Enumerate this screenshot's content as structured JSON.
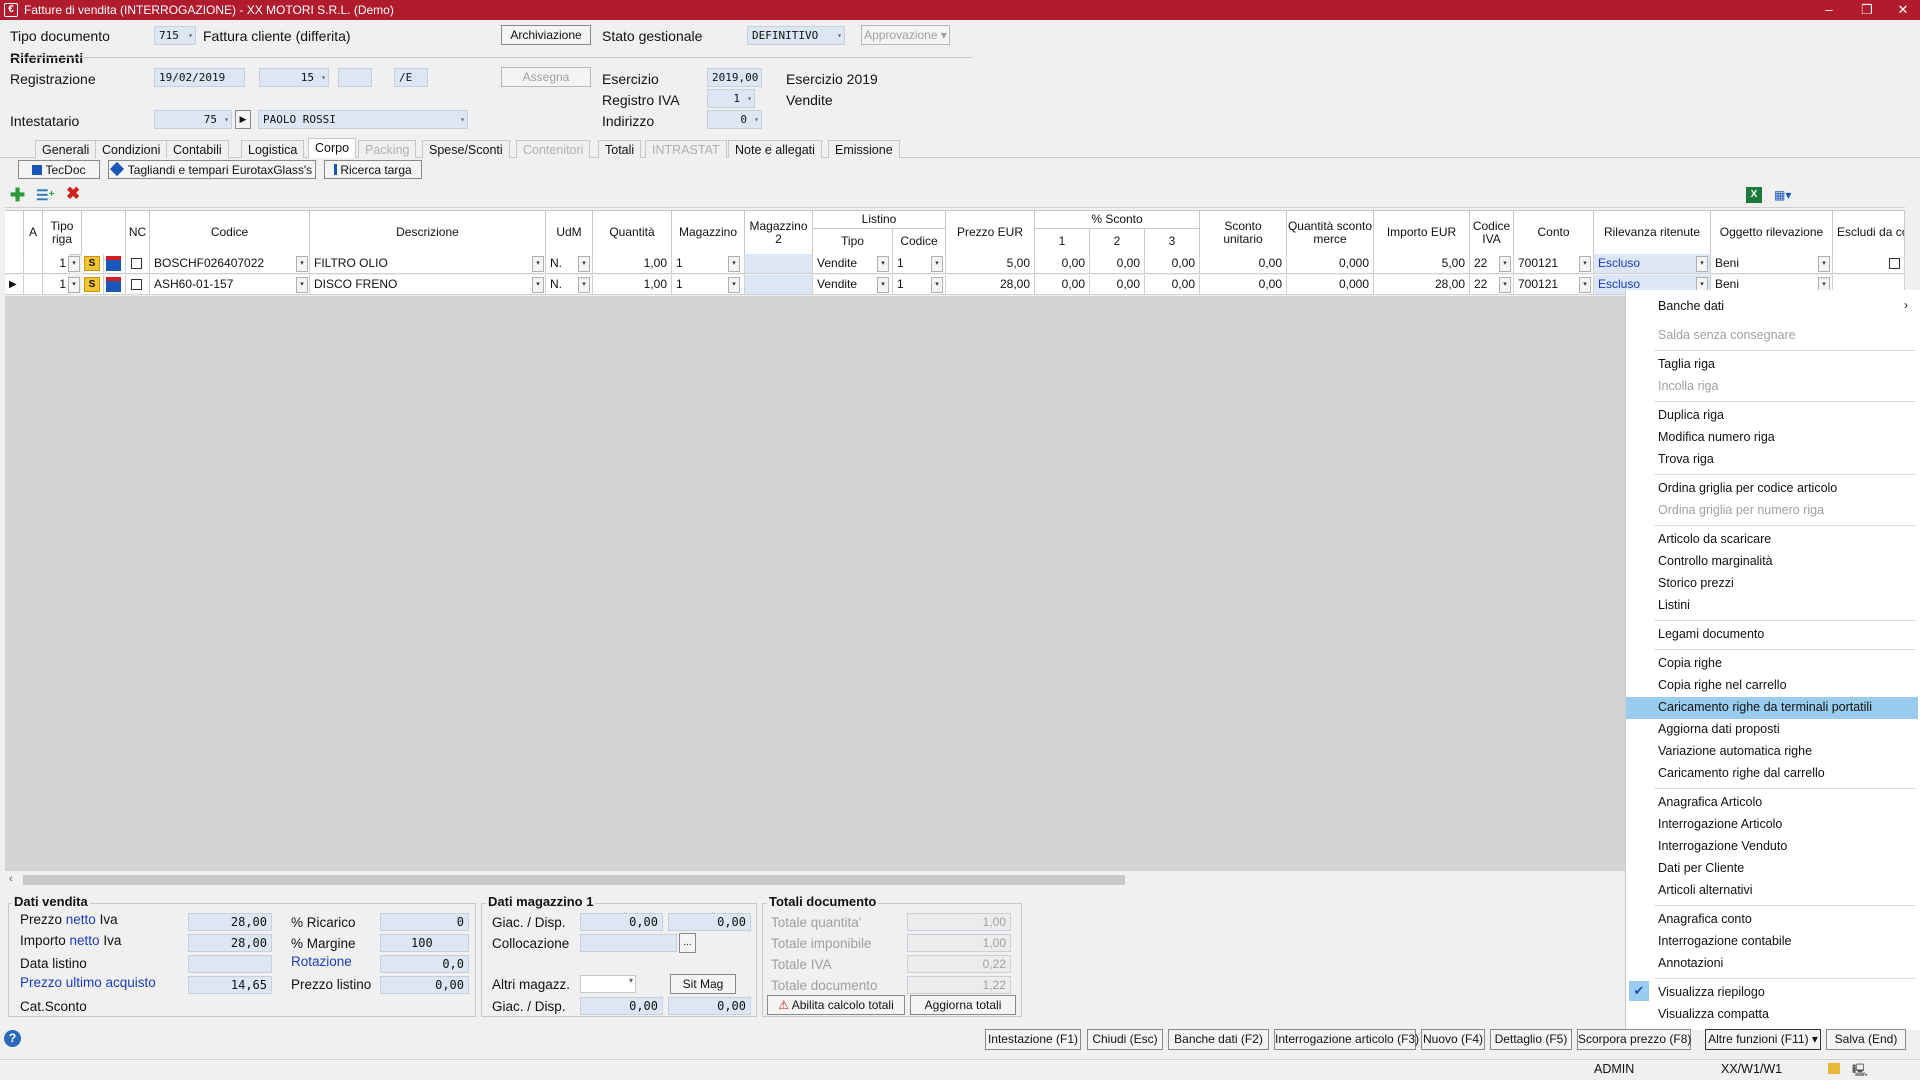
{
  "window": {
    "title": "Fatture di vendita (INTERROGAZIONE)  - XX  MOTORI S.R.L.  (Demo)",
    "minimize": "–",
    "restore": "❐",
    "close": "✕"
  },
  "header": {
    "tipo_documento_label": "Tipo documento",
    "tipo_documento_code": "715",
    "tipo_documento_desc": "Fattura cliente (differita)",
    "archiviazione_btn": "Archiviazione",
    "stato_gestionale_label": "Stato gestionale",
    "stato_gestionale_value": "DEFINITIVO",
    "approvazione_btn": "Approvazione",
    "riferimenti_label": "Riferimenti",
    "registrazione_label": "Registrazione",
    "registrazione_date": "19/02/2019",
    "registrazione_num": "15",
    "registrazione_suffix": "/E",
    "assegna_btn": "Assegna",
    "esercizio_label": "Esercizio",
    "esercizio_value": "2019,00",
    "esercizio_desc": "Esercizio 2019",
    "registro_iva_label": "Registro IVA",
    "registro_iva_value": "1",
    "registro_iva_desc": "Vendite",
    "intestatario_label": "Intestatario",
    "intestatario_code": "75",
    "intestatario_name": "PAOLO ROSSI",
    "indirizzo_label": "Indirizzo",
    "indirizzo_value": "0"
  },
  "tabs": [
    {
      "label": "Generali",
      "state": "normal"
    },
    {
      "label": "Condizioni",
      "state": "normal"
    },
    {
      "label": "Contabili",
      "state": "normal"
    },
    {
      "label": "Logistica",
      "state": "normal"
    },
    {
      "label": "Corpo",
      "state": "active"
    },
    {
      "label": "Packing",
      "state": "disabled"
    },
    {
      "label": "Spese/Sconti",
      "state": "normal"
    },
    {
      "label": "Contenitori",
      "state": "disabled"
    },
    {
      "label": "Totali",
      "state": "normal"
    },
    {
      "label": "INTRASTAT",
      "state": "disabled"
    },
    {
      "label": "Note e allegati",
      "state": "normal"
    },
    {
      "label": "Emissione",
      "state": "normal"
    }
  ],
  "subtoolbar": {
    "tecdoc": "TecDoc",
    "tagliandi": "Tagliandi e tempari EurotaxGlass's",
    "ricerca_targa": "Ricerca targa"
  },
  "grid": {
    "headers": {
      "a": "A",
      "tipo_riga": "Tipo riga",
      "nc": "NC",
      "codice": "Codice",
      "descrizione": "Descrizione",
      "udm": "UdM",
      "quantita": "Quantità",
      "magazzino": "Magazzino",
      "magazzino2": "Magazzino 2",
      "listino": "Listino",
      "listino_tipo": "Tipo",
      "listino_codice": "Codice",
      "prezzo": "Prezzo EUR",
      "sconto": "% Sconto",
      "sconto1": "1",
      "sconto2": "2",
      "sconto3": "3",
      "sconto_unitario": "Sconto unitario",
      "qta_sconto_merce": "Quantità sconto merce",
      "importo": "Importo EUR",
      "codice_iva": "Codice IVA",
      "conto": "Conto",
      "rilevanza": "Rilevanza ritenute",
      "oggetto": "Oggetto rilevazione",
      "escludi": "Escludi da co operazi"
    },
    "rows": [
      {
        "tipo": "1",
        "s": "S",
        "codice": "BOSCHF026407022",
        "descrizione": "FILTRO OLIO",
        "udm": "N.",
        "quantita": "1,00",
        "magazzino": "1",
        "listino_tipo": "Vendite",
        "listino_codice": "1",
        "prezzo": "5,00",
        "sc1": "0,00",
        "sc2": "0,00",
        "sc3": "0,00",
        "sconto_unitario": "0,00",
        "qta_sconto": "0,000",
        "importo": "5,00",
        "iva": "22",
        "conto": "700121",
        "rilevanza": "Escluso",
        "oggetto": "Beni"
      },
      {
        "tipo": "1",
        "s": "S",
        "codice": "ASH60-01-157",
        "descrizione": "DISCO FRENO",
        "udm": "N.",
        "quantita": "1,00",
        "magazzino": "1",
        "listino_tipo": "Vendite",
        "listino_codice": "1",
        "prezzo": "28,00",
        "sc1": "0,00",
        "sc2": "0,00",
        "sc3": "0,00",
        "sconto_unitario": "0,00",
        "qta_sconto": "0,000",
        "importo": "28,00",
        "iva": "22",
        "conto": "700121",
        "rilevanza": "Escluso",
        "oggetto": "Beni"
      }
    ]
  },
  "context_menu": {
    "items": [
      {
        "label": "Banche dati",
        "state": "submenu"
      },
      {
        "label": "Salda senza consegnare",
        "state": "disabled"
      },
      {
        "label": "Taglia riga",
        "state": "normal"
      },
      {
        "label": "Incolla riga",
        "state": "disabled"
      },
      {
        "label": "Duplica riga",
        "state": "normal"
      },
      {
        "label": "Modifica numero riga",
        "state": "normal"
      },
      {
        "label": "Trova riga",
        "state": "normal"
      },
      {
        "label": "Ordina griglia per codice articolo",
        "state": "normal"
      },
      {
        "label": "Ordina griglia per numero riga",
        "state": "disabled"
      },
      {
        "label": "Articolo da scaricare",
        "state": "normal"
      },
      {
        "label": "Controllo marginalità",
        "state": "normal"
      },
      {
        "label": "Storico prezzi",
        "state": "normal"
      },
      {
        "label": "Listini",
        "state": "normal"
      },
      {
        "label": "Legami documento",
        "state": "normal"
      },
      {
        "label": "Copia righe",
        "state": "normal"
      },
      {
        "label": "Copia righe nel carrello",
        "state": "normal"
      },
      {
        "label": "Caricamento righe da terminali portatili",
        "state": "highlighted"
      },
      {
        "label": "Aggiorna dati proposti",
        "state": "normal"
      },
      {
        "label": "Variazione automatica righe",
        "state": "normal"
      },
      {
        "label": "Caricamento righe dal carrello",
        "state": "normal"
      },
      {
        "label": "Anagrafica Articolo",
        "state": "normal"
      },
      {
        "label": "Interrogazione Articolo",
        "state": "normal"
      },
      {
        "label": "Interrogazione Venduto",
        "state": "normal"
      },
      {
        "label": "Dati per Cliente",
        "state": "normal"
      },
      {
        "label": "Articoli alternativi",
        "state": "normal"
      },
      {
        "label": "Anagrafica conto",
        "state": "normal"
      },
      {
        "label": "Interrogazione contabile",
        "state": "normal"
      },
      {
        "label": "Annotazioni",
        "state": "normal"
      },
      {
        "label": "Visualizza riepilogo",
        "state": "checked"
      },
      {
        "label": "Visualizza compatta",
        "state": "normal"
      }
    ]
  },
  "dati_vendita": {
    "title": "Dati vendita",
    "prezzo_netto_label_a": "Prezzo ",
    "prezzo_netto_label_b": "netto",
    "prezzo_netto_label_c": " Iva",
    "prezzo_netto_value": "28,00",
    "importo_netto_label_a": "Importo ",
    "importo_netto_label_b": "netto",
    "importo_netto_label_c": " Iva",
    "importo_netto_value": "28,00",
    "data_listino_label": "Data listino",
    "data_listino_value": "",
    "prezzo_ultimo_label": "Prezzo ultimo acquisto",
    "prezzo_ultimo_value": "14,65",
    "cat_sconto_label": "Cat.Sconto",
    "ricarico_label": "% Ricarico",
    "ricarico_value": "0",
    "margine_label": "% Margine",
    "margine_value": "100",
    "rotazione_label": "Rotazione",
    "rotazione_value": "0,0",
    "prezzo_listino_label": "Prezzo listino",
    "prezzo_listino_value": "0,00"
  },
  "dati_magazzino": {
    "title": "Dati magazzino 1",
    "giac_label": "Giac. / Disp.",
    "giac1": "0,00",
    "disp1": "0,00",
    "collocazione_label": "Collocazione",
    "collocazione_btn": "...",
    "altri_label": "Altri magazz.",
    "sitmag_btn": "Sit Mag",
    "giac2_label": "Giac. / Disp.",
    "giac2": "0,00",
    "disp2": "0,00"
  },
  "totali_documento": {
    "title": "Totali documento",
    "quantita_label": "Totale quantita'",
    "quantita_value": "1,00",
    "imponibile_label": "Totale imponibile",
    "imponibile_value": "1,00",
    "iva_label": "Totale IVA",
    "iva_value": "0,22",
    "documento_label": "Totale documento",
    "documento_value": "1,22",
    "abilita_btn": "Abilita calcolo totali",
    "aggiorna_btn": "Aggiorna totali"
  },
  "footer": {
    "buttons": [
      "Intestazione (F1)",
      "Chiudi (Esc)",
      "Banche dati (F2)",
      "Interrogazione articolo (F3)",
      "Nuovo (F4)",
      "Dettaglio (F5)",
      "Scorpora prezzo (F8)",
      "Altre funzioni (F11)",
      "Salva (End)"
    ],
    "user": "ADMIN",
    "company": "XX/W1/W1"
  },
  "colors": {
    "titlebar": "#b01c2e",
    "field": "#dce6f4",
    "highlight": "#99ccee",
    "link_blue": "#1a3dbf"
  },
  "icons": [
    "app-icon",
    "add-row-icon",
    "insert-row-icon",
    "delete-row-icon",
    "excel-icon",
    "column-chooser-icon",
    "help-icon",
    "status-icon"
  ]
}
